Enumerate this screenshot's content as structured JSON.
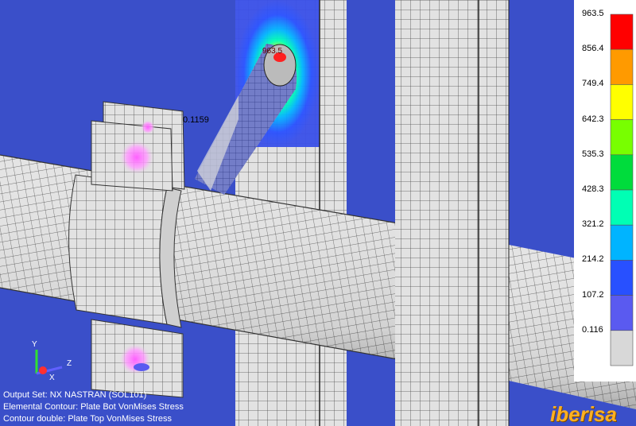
{
  "legend": {
    "values": [
      "963.5",
      "856.4",
      "749.4",
      "642.3",
      "535.3",
      "428.3",
      "321.2",
      "214.2",
      "107.2",
      "0.116"
    ],
    "colors": [
      "#ff0000",
      "#ff9a00",
      "#ffff00",
      "#78ff00",
      "#00dc3c",
      "#00ffb4",
      "#00b4ff",
      "#2850ff",
      "#5a5af0",
      "#d8d8d8"
    ]
  },
  "annotations": {
    "min_label": "0.1159",
    "max_label": "963.5"
  },
  "info": {
    "line1": "Output Set: NX NASTRAN (SOL101)",
    "line2": "Elemental Contour: Plate Bot VonMises Stress",
    "line3": "Contour double: Plate Top VonMises Stress"
  },
  "axes": {
    "x": "X",
    "y": "Y",
    "z": "Z"
  },
  "brand": "iberisa"
}
